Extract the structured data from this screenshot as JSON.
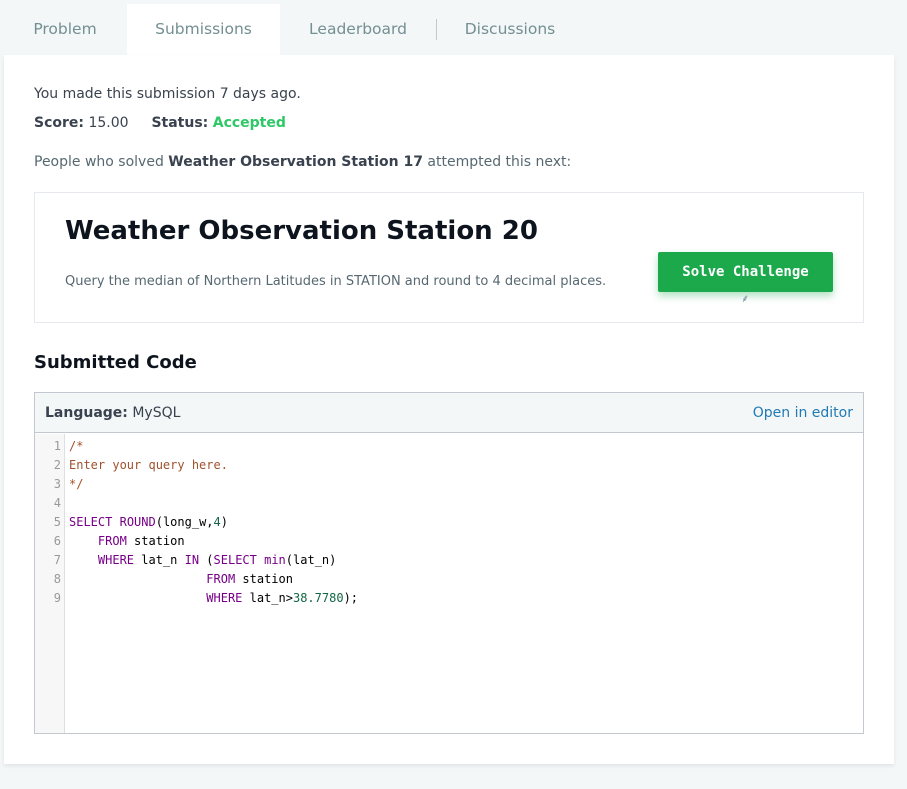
{
  "tabs": [
    {
      "label": "Problem",
      "active": false
    },
    {
      "label": "Submissions",
      "active": true
    },
    {
      "label": "Leaderboard",
      "active": false
    },
    {
      "label": "Discussions",
      "active": false
    }
  ],
  "submission": {
    "made_text": "You made this submission 7 days ago.",
    "score_label": "Score:",
    "score_value": "15.00",
    "status_label": "Status:",
    "status_value": "Accepted",
    "people_prefix": "People who solved ",
    "people_challenge": "Weather Observation Station 17",
    "people_suffix": " attempted this next:"
  },
  "next_challenge": {
    "title": "Weather Observation Station 20",
    "description": "Query the median of Northern Latitudes in STATION and round to 4 decimal places.",
    "button_label": "Solve Challenge"
  },
  "submitted_code": {
    "heading": "Submitted Code",
    "language_label": "Language:",
    "language_value": "MySQL",
    "open_in_editor": "Open in editor",
    "line_numbers": [
      "1",
      "2",
      "3",
      "4",
      "5",
      "6",
      "7",
      "8",
      "9"
    ]
  },
  "colors": {
    "accent_green": "#1ba94c",
    "accepted_green": "#2ec866",
    "link_blue": "#1f7ab5"
  }
}
